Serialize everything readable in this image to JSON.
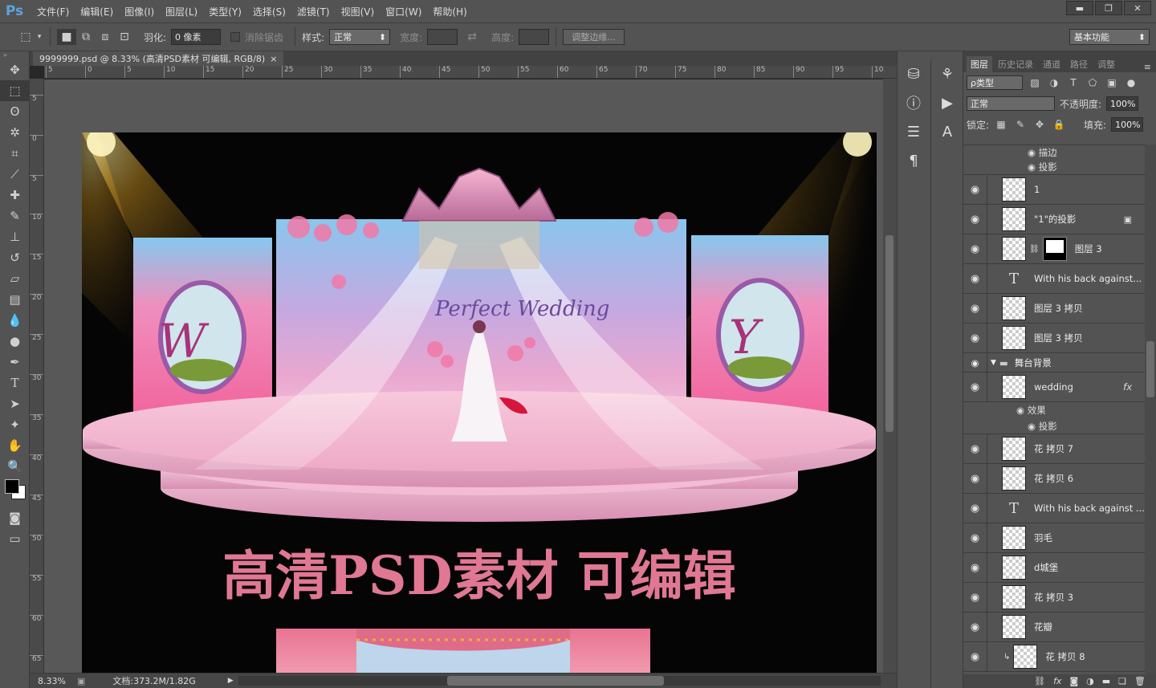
{
  "app": {
    "logo": "Ps"
  },
  "menu": [
    "文件(F)",
    "编辑(E)",
    "图像(I)",
    "图层(L)",
    "类型(Y)",
    "选择(S)",
    "滤镜(T)",
    "视图(V)",
    "窗口(W)",
    "帮助(H)"
  ],
  "window_buttons": {
    "minimize": "▬",
    "restore": "❐",
    "close": "✕"
  },
  "options": {
    "feather_label": "羽化:",
    "feather_value": "0 像素",
    "antialias_label": "消除锯齿",
    "style_label": "样式:",
    "style_value": "正常",
    "width_label": "宽度:",
    "height_label": "高度:",
    "refine_edge": "调整边缘...",
    "workspace": "基本功能"
  },
  "document": {
    "tab_title": "9999999.psd @ 8.33% (高清PSD素材 可编辑, RGB/8)",
    "tab_close": "×",
    "zoom": "8.33%",
    "doc_info": "文档:373.2M/1.82G"
  },
  "ruler_h_labels": [
    "5",
    "0",
    "5",
    "10",
    "15",
    "20",
    "25",
    "30",
    "35",
    "40",
    "45",
    "50",
    "55",
    "60",
    "65",
    "70",
    "75",
    "80",
    "85",
    "90",
    "95",
    "10"
  ],
  "ruler_v_labels": [
    "5",
    "0",
    "5",
    "10",
    "15",
    "20",
    "25",
    "30",
    "35",
    "40",
    "45",
    "50",
    "55",
    "60",
    "65"
  ],
  "canvas": {
    "headline": "高清PSD素材 可编辑",
    "script_text": "Perfect Wedding",
    "initial_left": "W",
    "initial_right": "Y"
  },
  "panels": {
    "tabs": [
      "图层",
      "历史记录",
      "通道",
      "路径",
      "调整"
    ],
    "kind_label": "ρ类型",
    "blend_mode": "正常",
    "opacity_label": "不透明度:",
    "opacity_value": "100%",
    "lock_label": "锁定:",
    "fill_label": "填充:",
    "fill_value": "100%"
  },
  "layers": {
    "top_partial": "描边",
    "top_shadow": "投影",
    "items": [
      {
        "name": "1"
      },
      {
        "name": "\"1\"的投影"
      },
      {
        "name": "图层 3"
      },
      {
        "name": "With his back  against..."
      },
      {
        "name": "图层 3 拷贝"
      },
      {
        "name": "图层 3 拷贝"
      },
      {
        "name": "舞台背景"
      },
      {
        "name": "wedding"
      },
      {
        "name": "花 拷贝 7"
      },
      {
        "name": "花 拷贝 6"
      },
      {
        "name": "With his back  against ..."
      },
      {
        "name": "羽毛"
      },
      {
        "name": "d城堡"
      },
      {
        "name": "花 拷贝 3"
      },
      {
        "name": "花瓣"
      },
      {
        "name": "花 拷贝 8"
      }
    ],
    "effects_label": "效果",
    "shadow_label": "投影",
    "fx_label": "fx"
  },
  "colors": {
    "accent": "#e07893",
    "ui_bg": "#535353",
    "canvas_bg": "#050506"
  }
}
